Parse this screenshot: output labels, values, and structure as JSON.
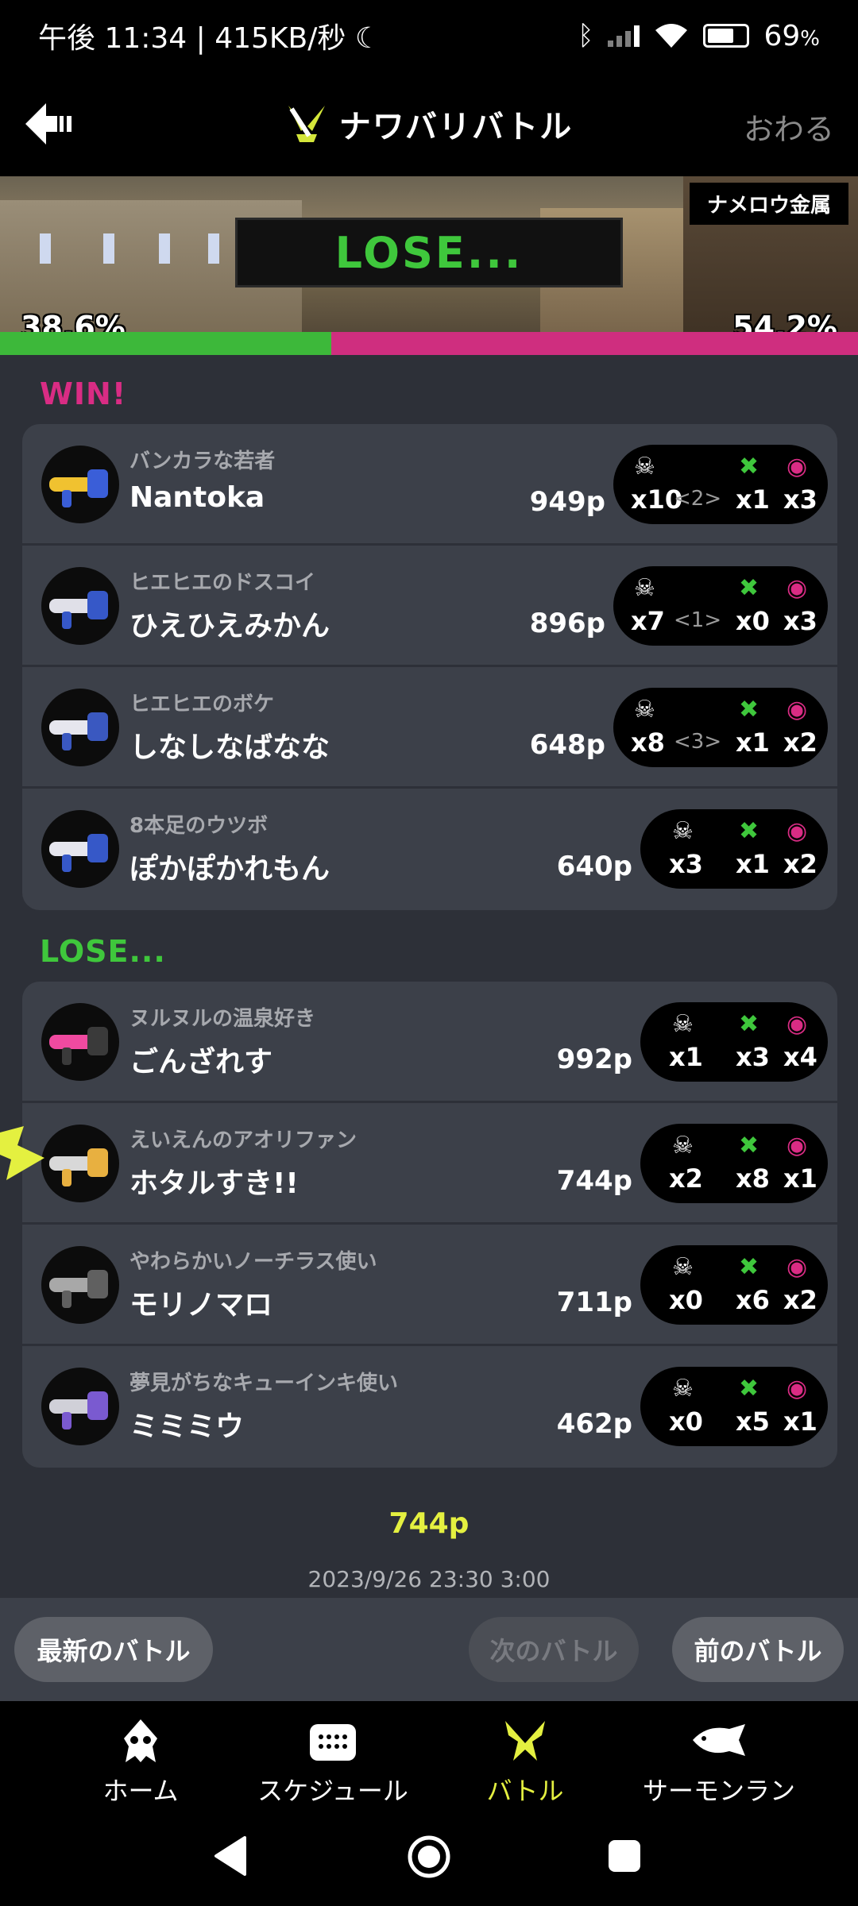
{
  "status_bar": {
    "time": "午後 11:34",
    "speed": "415KB/秒",
    "battery": "69"
  },
  "header": {
    "title": "ナワバリバトル",
    "quit": "おわる"
  },
  "banner": {
    "stage": "ナメロウ金属",
    "result": "LOSE...",
    "left_pct": "38.6%",
    "right_pct": "54.2%",
    "left_share": 0.386
  },
  "win": {
    "label": "WIN!",
    "players": [
      {
        "byname": "バンカラな若者",
        "name": "Nantoka",
        "points": "949p",
        "k": "x10",
        "a": "<2>",
        "d": "x1",
        "s": "x3"
      },
      {
        "byname": "ヒエヒエのドスコイ",
        "name": "ひえひえみかん",
        "points": "896p",
        "k": "x7",
        "a": "<1>",
        "d": "x0",
        "s": "x3"
      },
      {
        "byname": "ヒエヒエのボケ",
        "name": "しなしなばなな",
        "points": "648p",
        "k": "x8",
        "a": "<3>",
        "d": "x1",
        "s": "x2"
      },
      {
        "byname": "8本足のウツボ",
        "name": "ぽかぽかれもん",
        "points": "640p",
        "k": "x3",
        "a": "",
        "d": "x1",
        "s": "x2"
      }
    ]
  },
  "lose": {
    "label": "LOSE...",
    "players": [
      {
        "byname": "ヌルヌルの温泉好き",
        "name": "ごんざれす",
        "points": "992p",
        "k": "x1",
        "a": "",
        "d": "x3",
        "s": "x4"
      },
      {
        "byname": "えいえんのアオリファン",
        "name": "ホタルすき!!",
        "points": "744p",
        "k": "x2",
        "a": "",
        "d": "x8",
        "s": "x1"
      },
      {
        "byname": "やわらかいノーチラス使い",
        "name": "モリノマロ",
        "points": "711p",
        "k": "x0",
        "a": "",
        "d": "x6",
        "s": "x2"
      },
      {
        "byname": "夢見がちなキューインキ使い",
        "name": "ミミミウ",
        "points": "462p",
        "k": "x0",
        "a": "",
        "d": "x5",
        "s": "x1"
      }
    ]
  },
  "summary": {
    "total": "744p",
    "date": "2023/9/26 23:30 3:00"
  },
  "battle_nav": {
    "latest": "最新のバトル",
    "next": "次のバトル",
    "prev": "前のバトル"
  },
  "tabs": [
    "ホーム",
    "スケジュール",
    "バトル",
    "サーモンラン"
  ],
  "colors": {
    "win": "#d92c84",
    "lose": "#3fc73c",
    "accent": "#e4f040"
  }
}
